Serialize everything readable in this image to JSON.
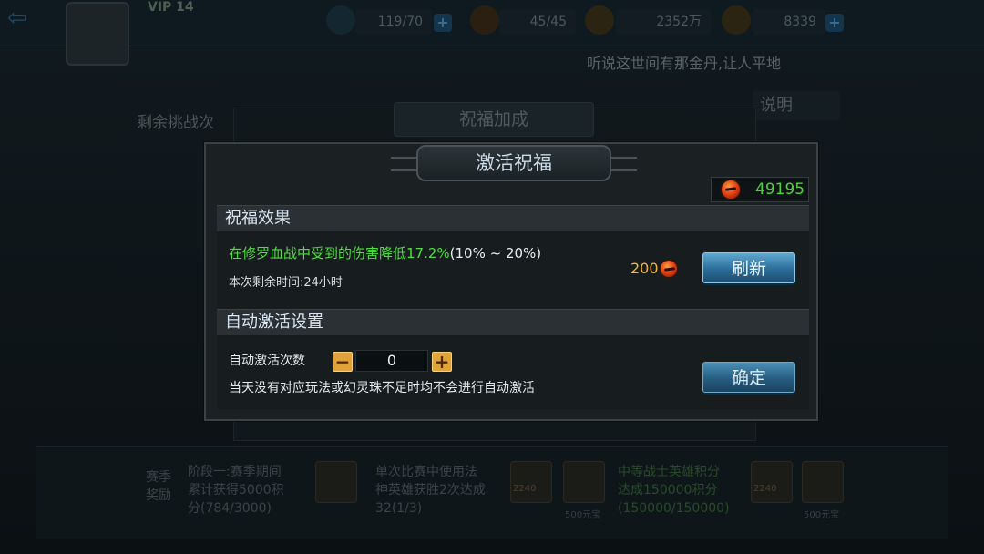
{
  "background": {
    "vip_label": "VIP 14",
    "resources": [
      {
        "value": "119/70",
        "icon": "stamina-icon",
        "plus": "+"
      },
      {
        "value": "45/45",
        "icon": "energy-icon",
        "plus": ""
      },
      {
        "value": "2352万",
        "icon": "gold-coin-icon",
        "plus": ""
      },
      {
        "value": "8339",
        "icon": "ingot-icon",
        "plus": "+"
      }
    ],
    "tip_text": "听说这世间有那金丹,让人平地",
    "remaining_label": "剩余挑战次",
    "explain_label": "说明",
    "panel_title": "祝福加成",
    "bottom_labels": [
      "赛季\n奖励",
      "阶段一:赛季期间\n累计获得5000积\n分(784/3000)",
      "单次比赛中使用法\n神英雄获胜2次达成\n32(1/3)",
      "中等战士英雄积分\n达成150000积分\n(150000/150000)"
    ],
    "coin_labels": [
      "500元宝",
      "500元宝"
    ],
    "box_numbers": [
      "2240",
      "2240"
    ]
  },
  "modal": {
    "title": "激活祝福",
    "currency_icon": "gem-icon",
    "currency_value": "49195",
    "blessing_section": {
      "header": "祝福效果",
      "effect_text": "在修罗血战中受到的伤害降低17.2%",
      "effect_range": "(10% ~ 20%)",
      "remaining_time": "本次剩余时间:24小时",
      "refresh_cost": "200",
      "refresh_button": "刷新"
    },
    "auto_section": {
      "header": "自动激活设置",
      "count_label": "自动激活次数",
      "minus": "−",
      "plus": "+",
      "count_value": "0",
      "note": "当天没有对应玩法或幻灵珠不足时均不会进行自动激活",
      "confirm_button": "确定"
    }
  },
  "colors": {
    "accent_green": "#4be03c",
    "cost_gold": "#f2b53a",
    "button_blue": "#2a6d99",
    "stepper_orange": "#e2a23a"
  }
}
